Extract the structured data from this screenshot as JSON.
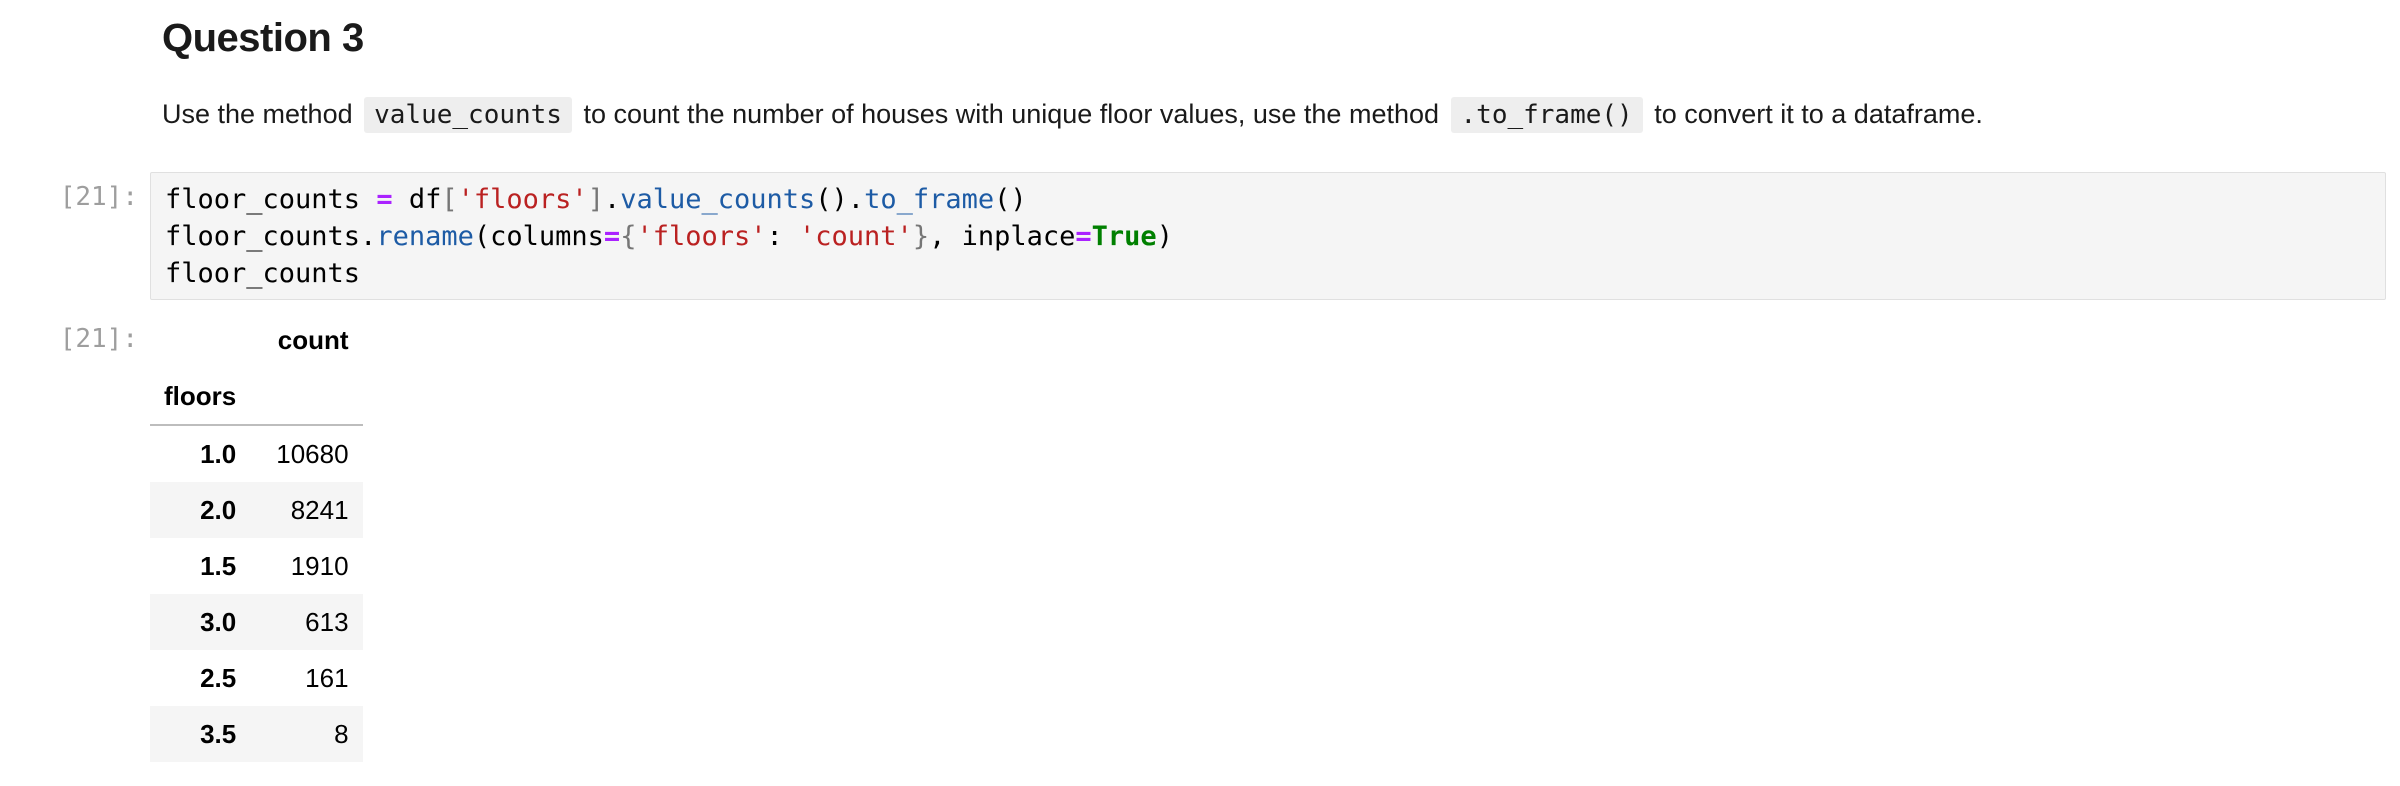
{
  "markdown": {
    "title": "Question 3",
    "text_1": "Use the method ",
    "code_1": "value_counts",
    "text_2": " to count the number of houses with unique floor values, use the method ",
    "code_2": ".to_frame()",
    "text_3": " to convert it to a dataframe."
  },
  "code_cell": {
    "in_prompt": "[21]:",
    "line1": {
      "a": "floor_counts ",
      "eq": "=",
      "b": " df",
      "lb": "[",
      "s": "'floors'",
      "rb": "]",
      "dot1": ".",
      "fn1": "value_counts",
      "p1": "().",
      "fn2": "to_frame",
      "p2": "()"
    },
    "line2": {
      "a": "floor_counts.",
      "fn": "rename",
      "b": "(columns",
      "eq1": "=",
      "lc": "{",
      "s1": "'floors'",
      "colon": ": ",
      "s2": "'count'",
      "rc": "}",
      "c": ", inplace",
      "eq2": "=",
      "kw": "True",
      "d": ")"
    },
    "line3": "floor_counts"
  },
  "output": {
    "out_prompt": "[21]:",
    "column_header": "count",
    "index_name": "floors",
    "rows": [
      {
        "index": "1.0",
        "count": "10680"
      },
      {
        "index": "2.0",
        "count": "8241"
      },
      {
        "index": "1.5",
        "count": "1910"
      },
      {
        "index": "3.0",
        "count": "613"
      },
      {
        "index": "2.5",
        "count": "161"
      },
      {
        "index": "3.5",
        "count": "8"
      }
    ]
  }
}
